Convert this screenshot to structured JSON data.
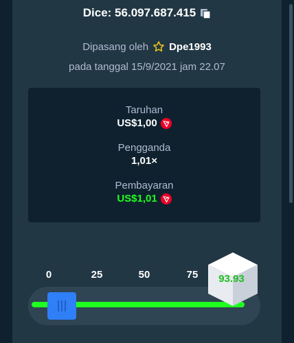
{
  "header": {
    "title": "Dice: 56.097.687.415"
  },
  "placed": {
    "prefix": "Dipasang oleh",
    "user": "Dpe1993",
    "date_line": "pada tanggal 15/9/2021 jam 22.07"
  },
  "bet_info": {
    "bet_label": "Taruhan",
    "bet_value": "US$1,00",
    "multiplier_label": "Pengganda",
    "multiplier_value": "1,01×",
    "payout_label": "Pembayaran",
    "payout_value": "US$1,01"
  },
  "slider": {
    "ticks": [
      "0",
      "25",
      "50",
      "75"
    ],
    "handle_value": 1.98,
    "result": "93.93"
  },
  "colors": {
    "accent": "#1fff20",
    "handle": "#2f7ff7",
    "background": "#0f212e",
    "panel": "#213743",
    "tron": "#ef0027"
  },
  "icons": [
    "copy-icon",
    "star-icon",
    "tron-icon"
  ]
}
